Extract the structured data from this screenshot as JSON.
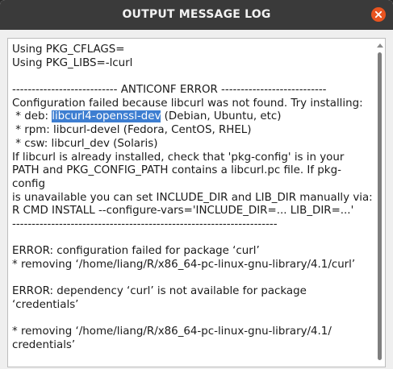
{
  "window": {
    "title": "OUTPUT MESSAGE LOG",
    "close_icon": "close-icon",
    "accent_color": "#e95420"
  },
  "log": {
    "lines": [
      "Using PKG_CFLAGS=",
      "Using PKG_LIBS=-lcurl",
      "",
      "--------------------------- ANTICONF ERROR ---------------------------",
      "Configuration failed because libcurl was not found. Try installing:",
      {
        "pre": " * deb: ",
        "selected": "libcurl4-openssl-dev",
        "post": " (Debian, Ubuntu, etc)"
      },
      " * rpm: libcurl-devel (Fedora, CentOS, RHEL)",
      " * csw: libcurl_dev (Solaris)",
      "If libcurl is already installed, check that 'pkg-config' is in your",
      "PATH and PKG_CONFIG_PATH contains a libcurl.pc file. If pkg-",
      "config",
      "is unavailable you can set INCLUDE_DIR and LIB_DIR manually via:",
      "R CMD INSTALL --configure-vars='INCLUDE_DIR=... LIB_DIR=...'",
      "--------------------------------------------------------------------",
      "",
      "ERROR: configuration failed for package ‘curl’",
      "* removing ‘/home/liang/R/x86_64-pc-linux-gnu-library/4.1/curl’",
      "",
      "ERROR: dependency ‘curl’ is not available for package",
      "‘credentials’",
      "",
      "* removing ‘/home/liang/R/x86_64-pc-linux-gnu-library/4.1/",
      "credentials’"
    ],
    "selection_color": "#3d7ed1"
  }
}
